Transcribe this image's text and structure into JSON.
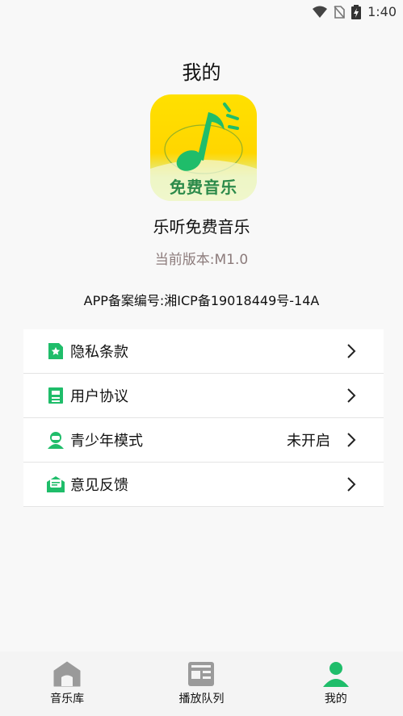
{
  "status_bar": {
    "time": "1:40"
  },
  "page": {
    "title": "我的"
  },
  "app": {
    "icon_text": "免费音乐",
    "name": "乐听免费音乐",
    "version": "当前版本:M1.0",
    "icp": "APP备案编号:湘ICP备19018449号-14A"
  },
  "menu": {
    "items": [
      {
        "label": "隐私条款",
        "icon": "privacy-doc-icon",
        "value": ""
      },
      {
        "label": "用户协议",
        "icon": "agreement-doc-icon",
        "value": ""
      },
      {
        "label": "青少年模式",
        "icon": "youth-avatar-icon",
        "value": "未开启"
      },
      {
        "label": "意见反馈",
        "icon": "feedback-mail-icon",
        "value": ""
      }
    ]
  },
  "tabs": [
    {
      "label": "音乐库",
      "icon": "home-icon",
      "active": false
    },
    {
      "label": "播放队列",
      "icon": "playlist-icon",
      "active": false
    },
    {
      "label": "我的",
      "icon": "profile-icon",
      "active": true
    }
  ],
  "colors": {
    "accent": "#1fbd6a",
    "inactive": "#9a9a9a",
    "version_text": "#8c7b7b"
  }
}
